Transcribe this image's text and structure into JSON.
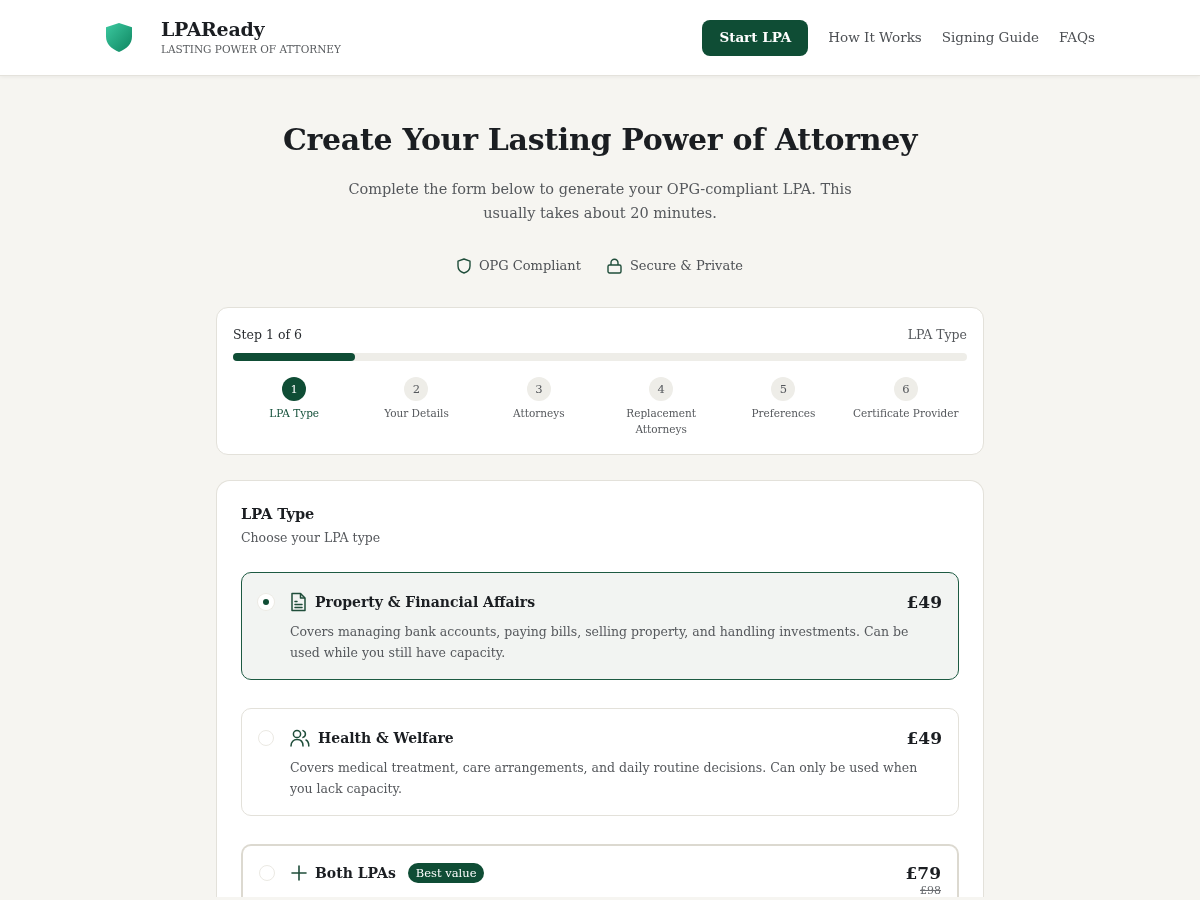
{
  "header": {
    "brand": "LPAReady",
    "tagline": "LASTING POWER OF ATTORNEY",
    "cta": "Start LPA",
    "nav_links": [
      "How It Works",
      "Signing Guide",
      "FAQs"
    ]
  },
  "hero": {
    "title": "Create Your Lasting Power of Attorney",
    "subtitle": "Complete the form below to generate your OPG-compliant LPA. This usually takes about 20 minutes.",
    "badges": [
      "OPG Compliant",
      "Secure & Private"
    ]
  },
  "progress": {
    "step_label": "Step 1 of 6",
    "current_name": "LPA Type",
    "level": 0.1667,
    "steps": [
      {
        "number": "1",
        "label": "LPA Type",
        "selected": true
      },
      {
        "number": "2",
        "label": "Your Details",
        "selected": false
      },
      {
        "number": "3",
        "label": "Attorneys",
        "selected": false
      },
      {
        "number": "4",
        "label": "Replacement Attorneys",
        "selected": false
      },
      {
        "number": "5",
        "label": "Preferences",
        "selected": false
      },
      {
        "number": "6",
        "label": "Certificate Provider",
        "selected": false
      }
    ]
  },
  "lpa_form": {
    "title": "LPA Type",
    "subtitle": "Choose your LPA type",
    "options": [
      {
        "title": "Property & Financial Affairs",
        "price": "£49",
        "description": "Covers managing bank accounts, paying bills, selling property, and handling investments. Can be used while you still have capacity.",
        "selected": true
      },
      {
        "title": "Health & Welfare",
        "price": "£49",
        "description": "Covers medical treatment, care arrangements, and daily routine decisions. Can only be used when you lack capacity.",
        "selected": false
      },
      {
        "title": "Both LPAs",
        "badge": "Best value",
        "price": "£79",
        "old_price": "£98",
        "selected": false
      }
    ]
  }
}
